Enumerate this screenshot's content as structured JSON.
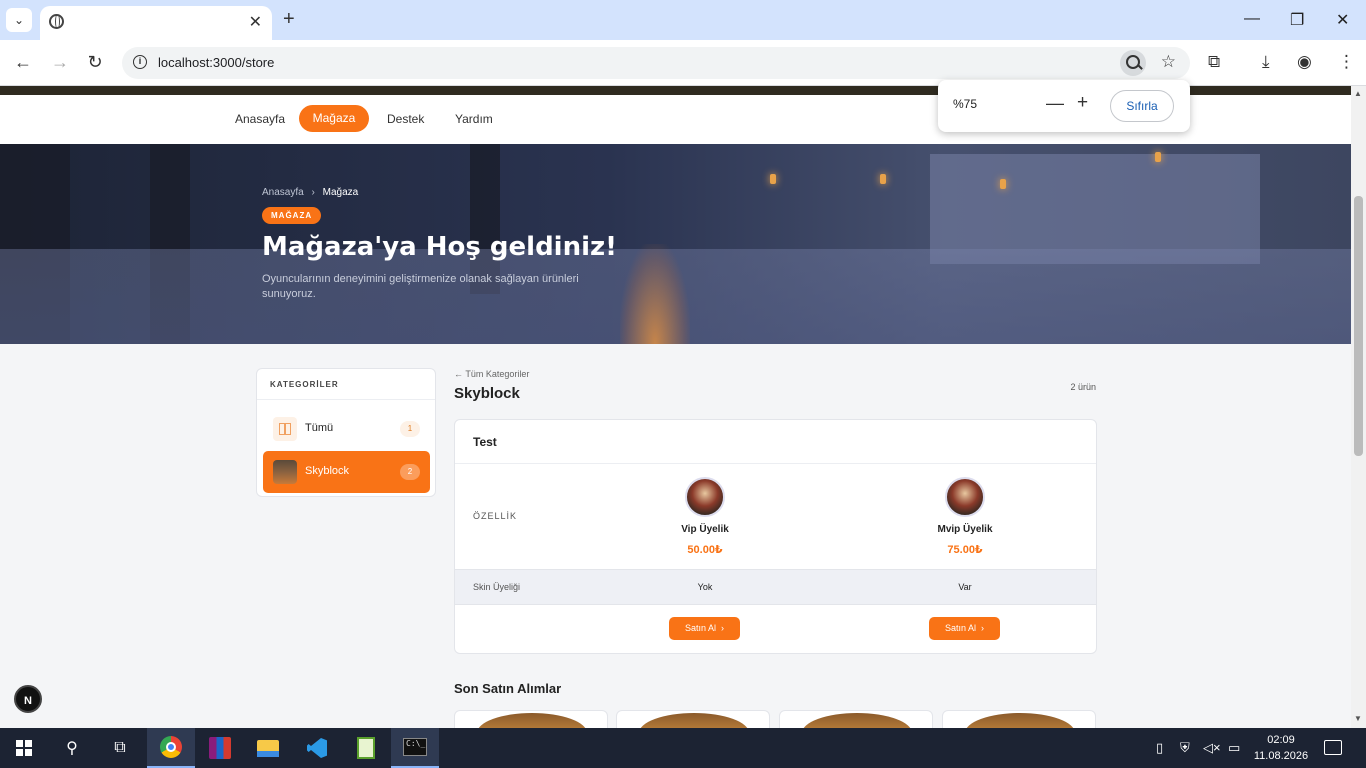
{
  "browser": {
    "url": "localhost:3000/store",
    "zoom_popup": {
      "percent": "%75",
      "reset_label": "Sıfırla"
    }
  },
  "site_nav": {
    "items": [
      {
        "label": "Anasayfa"
      },
      {
        "label": "Mağaza",
        "active": true
      },
      {
        "label": "Destek"
      },
      {
        "label": "Yardım"
      }
    ]
  },
  "hero": {
    "breadcrumb_home": "Anasayfa",
    "breadcrumb_sep": "›",
    "breadcrumb_current": "Mağaza",
    "badge": "MAĞAZA",
    "title": "Mağaza'ya Hoş geldiniz!",
    "description": "Oyuncularının deneyimini geliştirmenize olanak sağlayan ürünleri sunuyoruz."
  },
  "categories": {
    "heading": "KATEGORİLER",
    "items": [
      {
        "label": "Tümü",
        "count": "1",
        "icon": "grid-icon"
      },
      {
        "label": "Skyblock",
        "count": "2",
        "icon": "skyblock-thumbnail",
        "active": true
      }
    ]
  },
  "main": {
    "back_link": "← Tüm Kategoriler",
    "title": "Skyblock",
    "product_count": "2 ürün",
    "card": {
      "title": "Test",
      "feature_header": "ÖZELLİK",
      "products": [
        {
          "name": "Vip Üyelik",
          "price": "50.00₺",
          "feature_value": "Yok",
          "buy_label": "Satın Al"
        },
        {
          "name": "Mvip Üyelik",
          "price": "75.00₺",
          "feature_value": "Var",
          "buy_label": "Satın Al"
        }
      ],
      "feature_row_label": "Skin Üyeliği"
    },
    "recent_title": "Son Satın Alımlar"
  },
  "next_badge": "N",
  "taskbar": {
    "time": "02:09",
    "date": "11.08.2026"
  },
  "colors": {
    "accent": "#f97316",
    "tab_strip": "#d3e3fd",
    "taskbar": "#1c2333"
  }
}
